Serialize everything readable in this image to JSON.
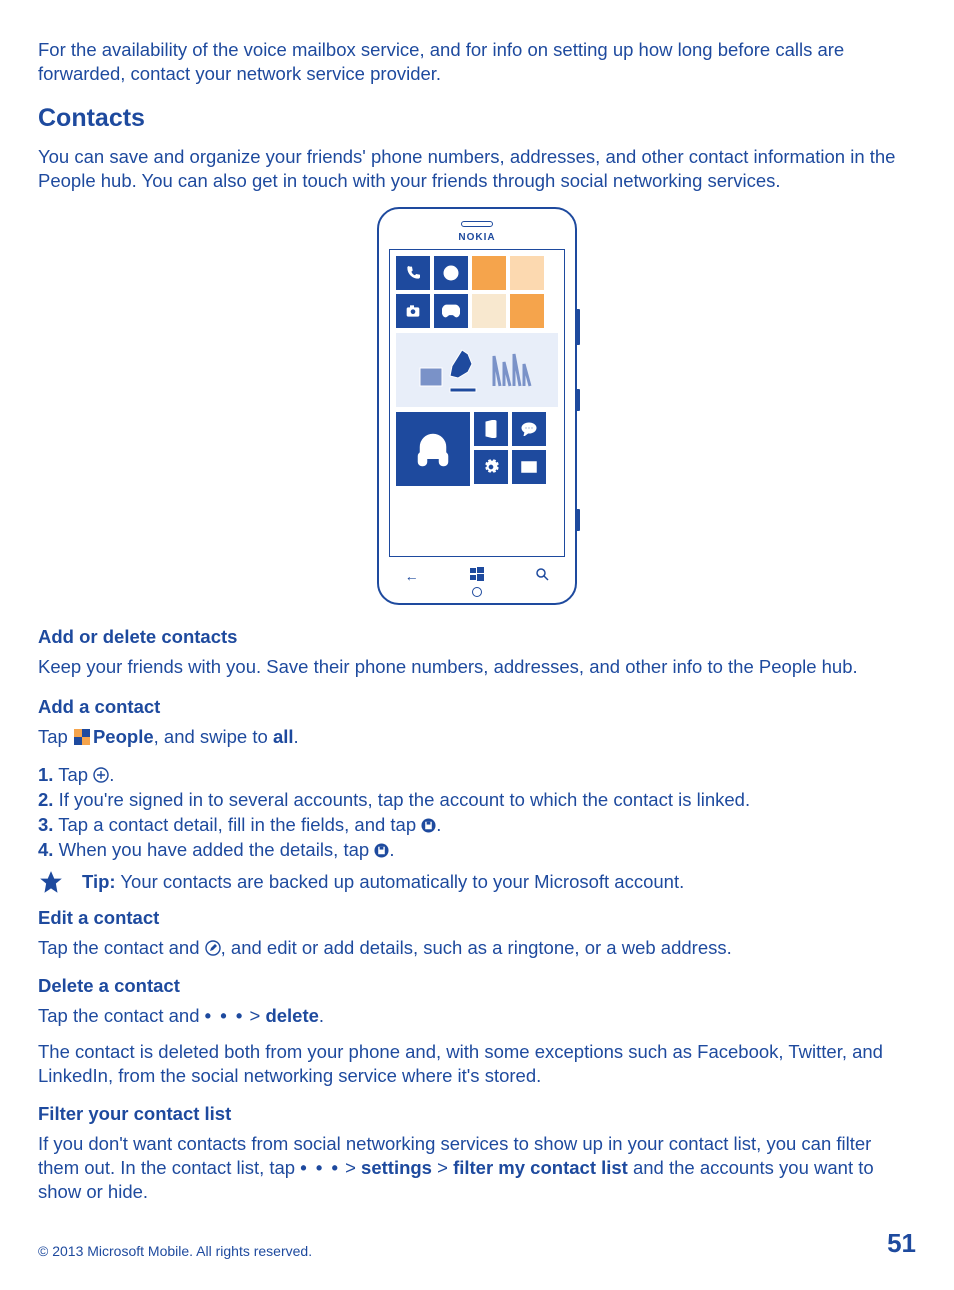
{
  "intro": "For the availability of the voice mailbox service, and for info on setting up how long before calls are forwarded, contact your network service provider.",
  "heading": "Contacts",
  "heading_desc": "You can save and organize your friends' phone numbers, addresses, and other contact information in the People hub. You can also get in touch with your friends through social networking services.",
  "phone_logo": "NOKIA",
  "sec1": {
    "title": "Add or delete contacts",
    "desc": "Keep your friends with you. Save their phone numbers, addresses, and other info to the People hub."
  },
  "add": {
    "title": "Add a contact",
    "lead_a": "Tap ",
    "lead_b": "People",
    "lead_c": ", and swipe to ",
    "lead_d": "all",
    "lead_e": ".",
    "s1a": "1.",
    "s1b": " Tap ",
    "s2a": "2.",
    "s2b": " If you're signed in to several accounts, tap the account to which the contact is linked.",
    "s3a": "3.",
    "s3b": " Tap a contact detail, fill in the fields, and tap ",
    "s4a": "4.",
    "s4b": " When you have added the details, tap "
  },
  "tip": {
    "label": "Tip:",
    "text": " Your contacts are backed up automatically to your Microsoft account."
  },
  "edit": {
    "title": "Edit a contact",
    "a": "Tap the contact and ",
    "b": ", and edit or add details, such as a ringtone, or a web address."
  },
  "del": {
    "title": "Delete a contact",
    "a": "Tap the contact and  ",
    "dots": "• • •",
    "gt": "  > ",
    "cmd": "delete",
    "end": ".",
    "desc": "The contact is deleted both from your phone and, with some exceptions such as Facebook, Twitter, and LinkedIn, from the social networking service where it's stored."
  },
  "filter": {
    "title": "Filter your contact list",
    "a": "If you don't want contacts from social networking services to show up in your contact list, you can filter them out. In the contact list, tap  ",
    "dots": "• • •",
    "gt1": "  > ",
    "settings": "settings",
    "gt2": " > ",
    "filter": "filter my contact list",
    "b": " and the accounts you want to show or hide."
  },
  "footer": {
    "copyright": "© 2013 Microsoft Mobile. All rights reserved.",
    "page": "51"
  }
}
